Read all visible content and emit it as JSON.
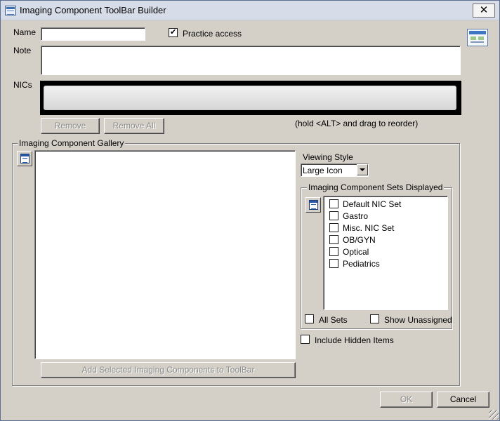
{
  "window": {
    "title": "Imaging Component ToolBar Builder",
    "close_glyph": "✕"
  },
  "form": {
    "name_label": "Name",
    "name_value": "",
    "practice_access_label": "Practice access",
    "practice_access_checked": true,
    "note_label": "Note",
    "note_value": "",
    "nics_label": "NICs",
    "remove_label": "Remove",
    "remove_all_label": "Remove All",
    "reorder_hint": "(hold <ALT> and drag to reorder)"
  },
  "gallery": {
    "title": "Imaging Component Gallery",
    "add_button_label": "Add Selected Imaging Components to ToolBar",
    "viewing_style_label": "Viewing Style",
    "viewing_style_selected": "Large Icon",
    "include_hidden_label": "Include Hidden Items",
    "include_hidden_checked": false
  },
  "sets": {
    "title": "Imaging Component Sets Displayed",
    "items": [
      {
        "label": "Default NIC Set",
        "checked": false
      },
      {
        "label": "Gastro",
        "checked": false
      },
      {
        "label": "Misc. NIC Set",
        "checked": false
      },
      {
        "label": "OB/GYN",
        "checked": false
      },
      {
        "label": "Optical",
        "checked": false
      },
      {
        "label": "Pediatrics",
        "checked": false
      }
    ],
    "all_sets_label": "All Sets",
    "show_unassigned_label": "Show Unassigned"
  },
  "footer": {
    "ok_label": "OK",
    "cancel_label": "Cancel"
  },
  "colors": {
    "window_bg": "#d4d0c8",
    "titlebar_bg": "#d7dde8",
    "nics_strip_bg": "#000000",
    "disabled_text": "#8c8c8c"
  },
  "icons": {
    "title_icon": "app-window-icon",
    "preview_icon": "toolbar-preview-icon",
    "gallery_icon": "list-view-icon",
    "sets_icon": "list-view-icon",
    "dropdown_icon": "dropdown-arrow-icon"
  }
}
